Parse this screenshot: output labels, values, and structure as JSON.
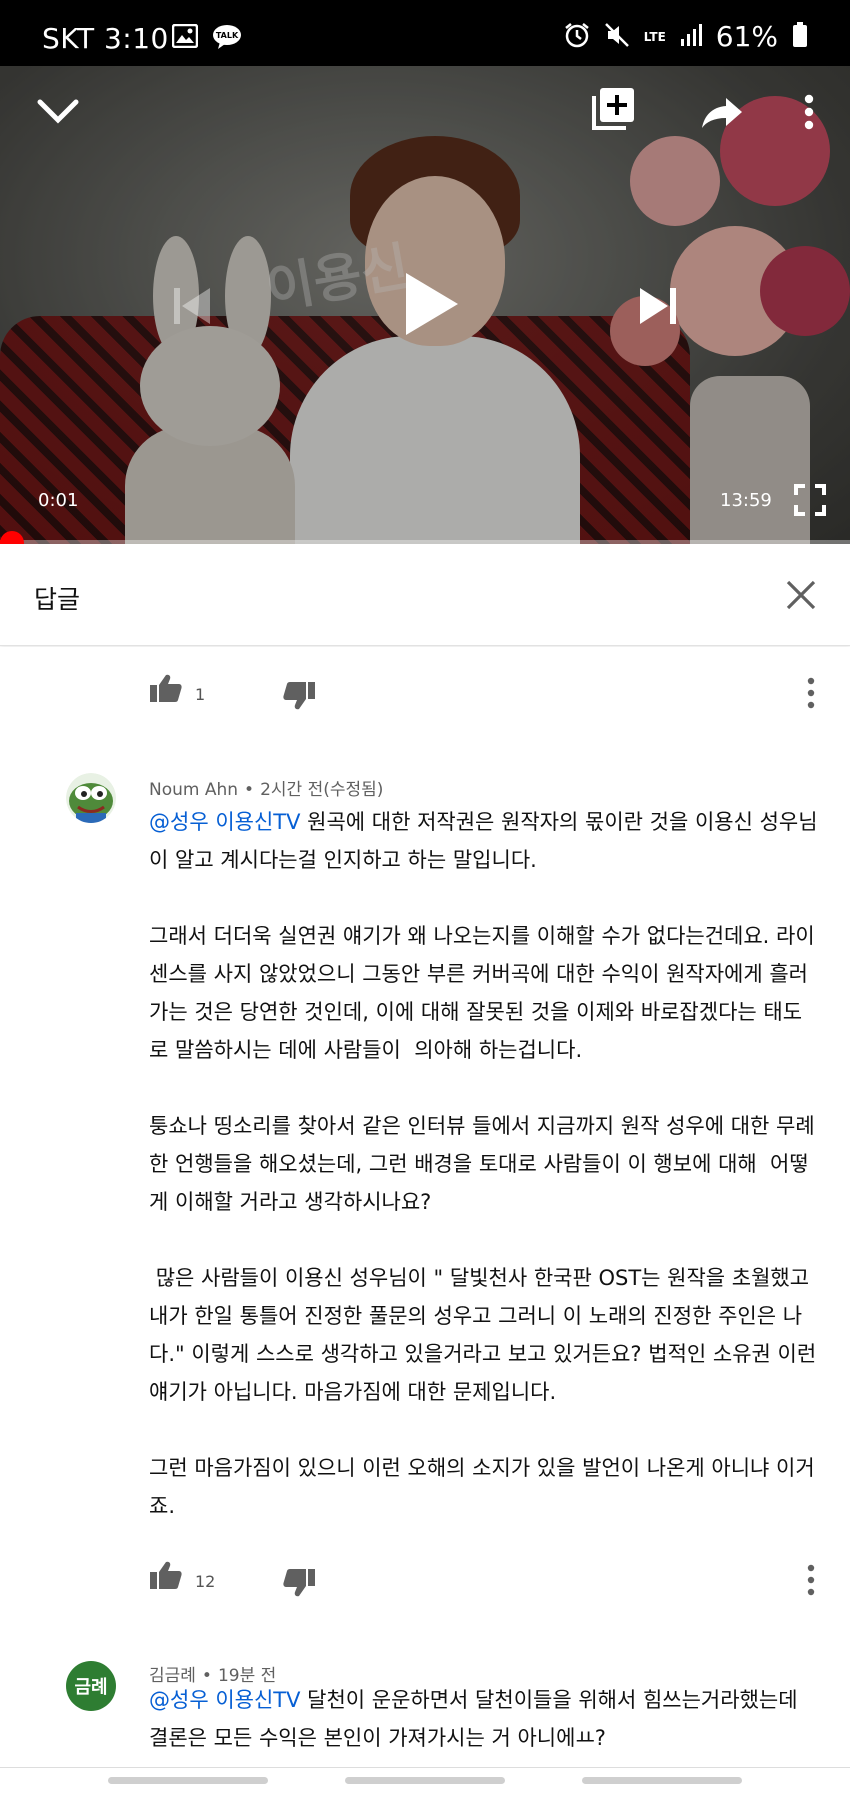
{
  "status_bar": {
    "carrier_time": "SKT 3:10",
    "network": "LTE",
    "battery": "61%"
  },
  "player": {
    "current_time": "0:01",
    "total_time": "13:59",
    "progress": 0.001,
    "watermark": "이용신"
  },
  "replies_panel": {
    "title": "답글"
  },
  "top_action_row": {
    "like_count": "1"
  },
  "comments": [
    {
      "author": "Noum Ahn",
      "time": "2시간 전(수정됨)",
      "mention": "@성우 이용신TV",
      "text_first": " 원곡에 대한 저작권은 원작자의 몫이란 것을 이용신 성우님이 알고 계시다는걸 인지하고 하는 말입니다.\n\n그래서 더더욱 실연권 얘기가 왜 나오는지를 이해할 수가 없다는건데요. 라이센스를 사지 않았었으니 그동안 부른 커버곡에 대한 수익이 원작자에게 흘러가는 것은 당연한 것인데, 이에 대해 잘못된 것을 이제와 바로잡겠다는 태도로 말씀하시는 데에 사람들이  의아해 하는겁니다.\n\n퉁쇼나 띵소리를 찾아서 같은 인터뷰 들에서 지금까지 원작 성우에 대한 무례한 언행들을 해오셨는데, 그런 배경을 토대로 사람들이 이 행보에 대해  어떻게 이해할 거라고 생각하시나요?\n\n 많은 사람들이 이용신 성우님이 \" 달빛천사 한국판 OST는 원작을 초월했고 내가 한일 통틀어 진정한 풀문의 성우고 그러니 이 노래의 진정한 주인은 나다.\" 이렇게 스스로 생각하고 있을거라고 보고 있거든요? 법적인 소유권 이런 얘기가 아닙니다. 마음가짐에 대한 문제입니다.\n\n그런 마음가짐이 있으니 이런 오해의 소지가 있을 발언이 나온게 아니냐 이거죠.",
      "like_count": "12"
    },
    {
      "author": "김금례",
      "avatar_text": "금례",
      "avatar_color": "#2e7d32",
      "time": "19분 전",
      "mention": "@성우 이용신TV",
      "text_first": " 달천이 운운하면서 달천이들을 위해서 힘쓰는거라했는데 결론은 모든 수익은 본인이 가져가시는 거 아니에ㅛ?"
    }
  ],
  "colors": {
    "mention": "#065fd4",
    "progress": "#ff0000",
    "status_bar": "#000000"
  },
  "icons": {
    "collapse": "chevron-down-icon",
    "add_to_playlist": "playlist-add-icon",
    "share": "share-icon",
    "more": "more-vert-icon",
    "previous": "skip-previous-icon",
    "play": "play-icon",
    "next": "skip-next-icon",
    "fullscreen": "fullscreen-icon",
    "close": "close-icon",
    "like": "thumbs-up-icon",
    "dislike": "thumbs-down-icon"
  }
}
